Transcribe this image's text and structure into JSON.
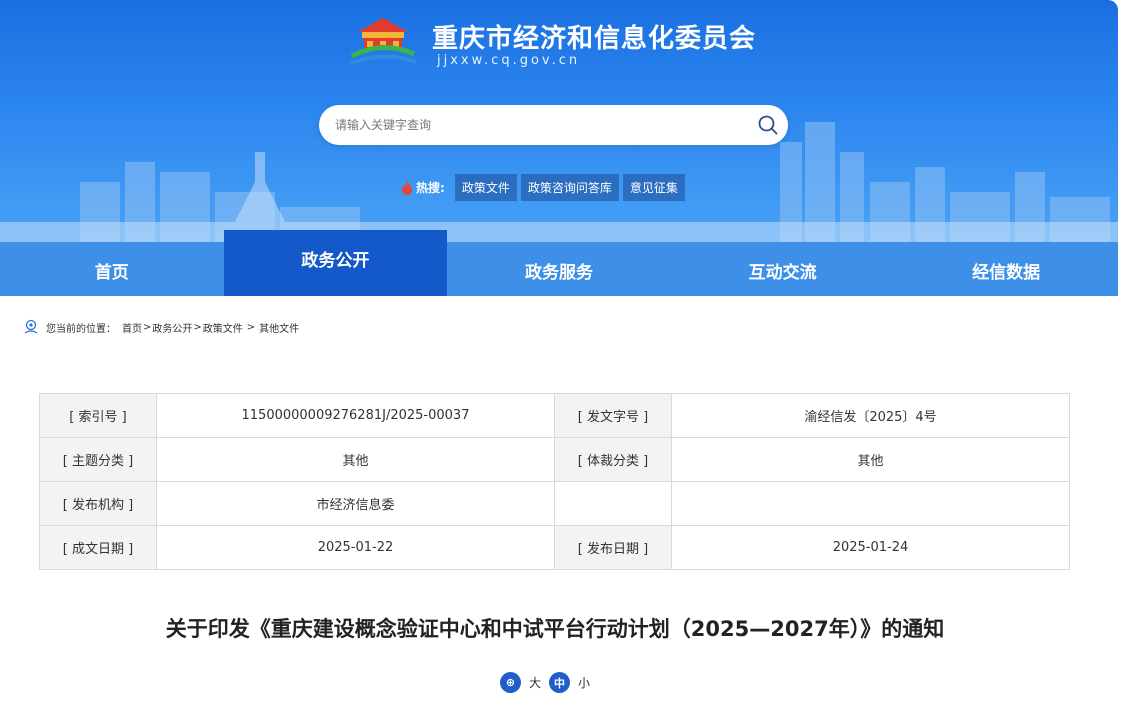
{
  "header": {
    "title": "重庆市经济和信息化委员会",
    "domain": "jjxxw.cq.gov.cn"
  },
  "search": {
    "placeholder": "请输入关键字查询"
  },
  "hot": {
    "label": "热搜:",
    "tags": [
      "政策文件",
      "政策咨询问答库",
      "意见征集"
    ]
  },
  "nav": {
    "items": [
      "首页",
      "政务公开",
      "政务服务",
      "互动交流",
      "经信数据"
    ],
    "active_index": 1
  },
  "breadcrumb": {
    "prefix": "您当前的位置：",
    "items": [
      "首页",
      "政务公开",
      "政策文件",
      "其他文件"
    ],
    "separator": ">"
  },
  "info": {
    "rows": [
      {
        "l1": "[ 索引号 ]",
        "v1": "11500000009276281J/2025-00037",
        "l2": "[ 发文字号 ]",
        "v2": "渝经信发〔2025〕4号"
      },
      {
        "l1": "[ 主题分类 ]",
        "v1": "其他",
        "l2": "[ 体裁分类 ]",
        "v2": "其他"
      },
      {
        "l1": "[ 发布机构 ]",
        "v1": "市经济信息委",
        "l2": "",
        "v2": ""
      },
      {
        "l1": "[ 成文日期 ]",
        "v1": "2025-01-22",
        "l2": "[ 发布日期 ]",
        "v2": "2025-01-24"
      }
    ]
  },
  "article": {
    "title": "关于印发《重庆建设概念验证中心和中试平台行动计划（2025—2027年）》的通知"
  },
  "font_ctrl": {
    "large_icon": "⊕",
    "large": "大",
    "medium_icon": "中",
    "small": "小"
  },
  "colors": {
    "header_blue": "#2c86ef",
    "nav_blue": "#3d8fe8",
    "nav_active": "#1359c9",
    "hot_icon": "#e8453c"
  }
}
